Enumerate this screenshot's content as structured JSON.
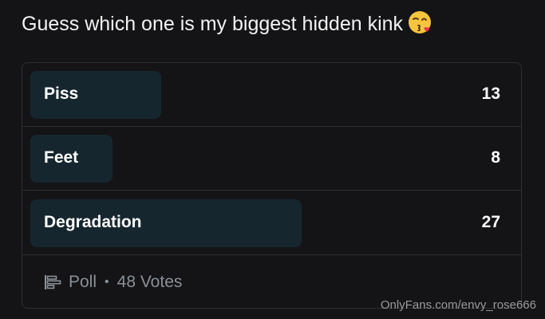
{
  "post": {
    "text": "Guess which one is my biggest hidden kink",
    "emoji_icon": "face-blowing-kiss-icon"
  },
  "poll": {
    "options": [
      {
        "label": "Piss",
        "count": "13",
        "fraction": 0.27
      },
      {
        "label": "Feet",
        "count": "8",
        "fraction": 0.17
      },
      {
        "label": "Degradation",
        "count": "27",
        "fraction": 0.56
      }
    ],
    "type_label": "Poll",
    "separator": "•",
    "votes_label": "48 Votes",
    "icon": "poll-bars-icon"
  },
  "watermark": "OnlyFans.com/envy_rose666",
  "colors": {
    "background": "#141416",
    "bar_fill": "#16262e",
    "border": "#2c2f33",
    "muted_text": "#8a9096"
  }
}
